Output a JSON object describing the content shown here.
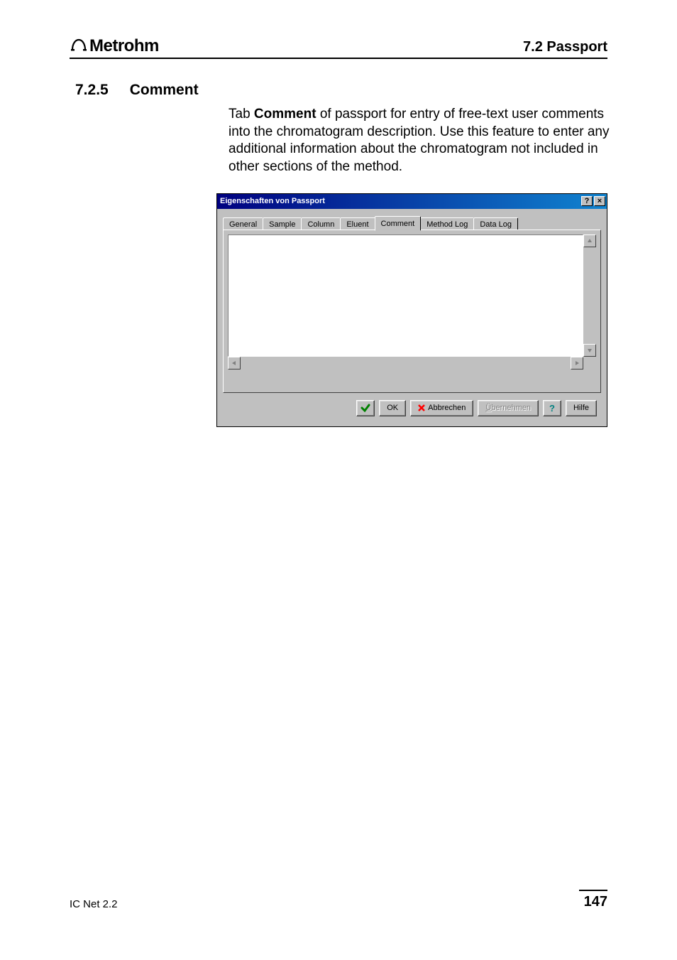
{
  "header": {
    "brand": "Metrohm",
    "section": "7.2  Passport"
  },
  "section": {
    "number": "7.2.5",
    "title": "Comment"
  },
  "paragraph": {
    "lead": "Tab ",
    "bold": "Comment",
    "rest": " of passport for entry of free-text user comments into the chromatogram description. Use this feature to enter any additional information about the chromatogram not included in other sections of the method."
  },
  "dialog": {
    "title": "Eigenschaften von Passport",
    "titlebar_help": "?",
    "titlebar_close": "×",
    "tabs": [
      "General",
      "Sample",
      "Column",
      "Eluent",
      "Comment",
      "Method Log",
      "Data Log"
    ],
    "active_tab_index": 4,
    "comment_value": "",
    "buttons": {
      "ok": "OK",
      "cancel": "Abbrechen",
      "apply_prefix": "Ü",
      "apply_rest": "bernehmen",
      "help": "Hilfe"
    }
  },
  "footer": {
    "product": "IC Net 2.2",
    "page": "147"
  }
}
